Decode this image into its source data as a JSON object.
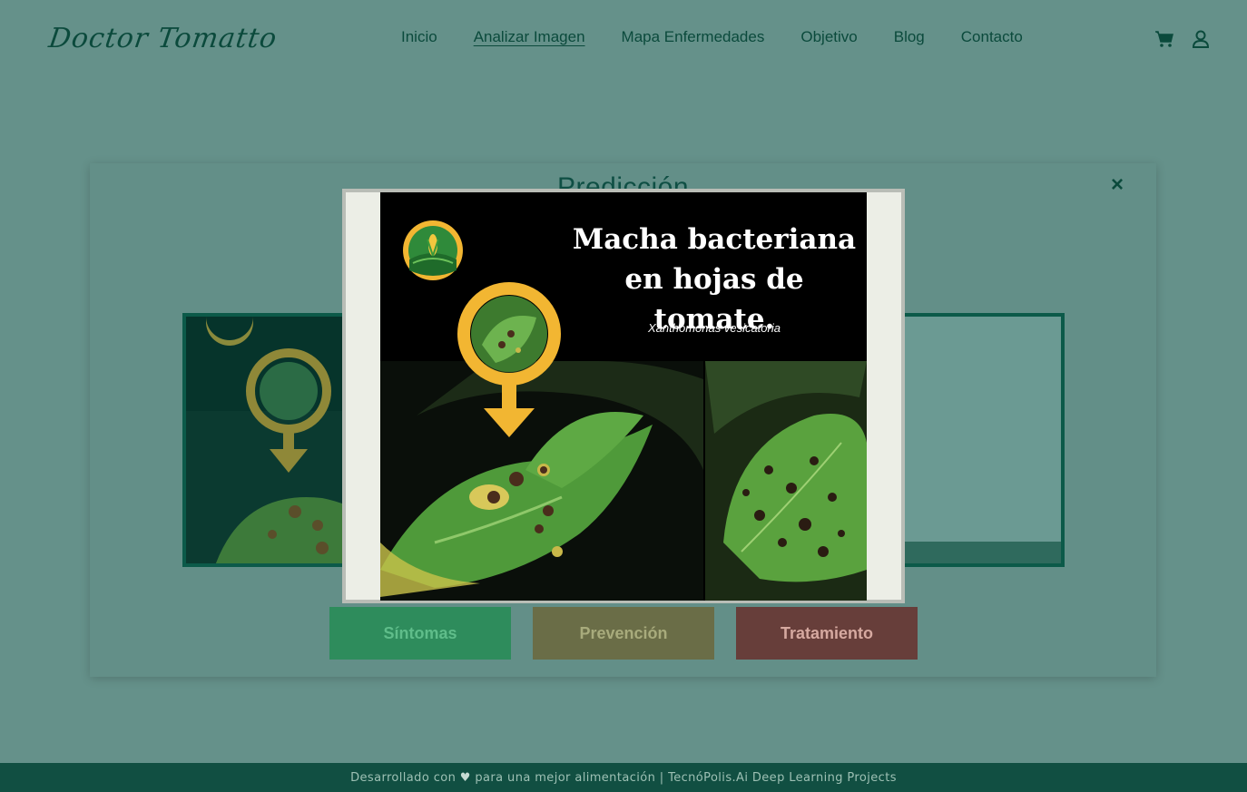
{
  "header": {
    "logo_text": "Doctor Tomatto",
    "nav": [
      {
        "label": "Inicio"
      },
      {
        "label": "Analizar Imagen"
      },
      {
        "label": "Mapa Enfermedades"
      },
      {
        "label": "Objetivo"
      },
      {
        "label": "Blog"
      },
      {
        "label": "Contacto"
      }
    ],
    "active_nav": "Analizar Imagen",
    "icons": [
      "cart-icon",
      "user-icon"
    ]
  },
  "card": {
    "title": "Predicción",
    "close_label": "×",
    "buttons": {
      "sintomas": "Síntomas",
      "prevencion": "Prevención",
      "tratamiento": "Tratamiento"
    }
  },
  "lightbox": {
    "title_line1": "Macha bacteriana",
    "title_line2": "en hojas de tomate.",
    "scientific_name": "Xanthomonas vesicatoria"
  },
  "footer": {
    "prefix": "Desarrollado con ",
    "heart": "♥",
    "middle": " para una mejor alimentación | ",
    "link": "TecnóPolis.Ai Deep Learning Projects"
  },
  "colors": {
    "page_bg": "#65918a",
    "primary_dark": "#0b4a3c",
    "footer_bg": "#114f42",
    "btn_sintomas": "#2e8c5c",
    "btn_prevencion": "#6a6d47",
    "btn_tratamiento": "#673e3a",
    "marker_yellow": "#f2b632"
  }
}
